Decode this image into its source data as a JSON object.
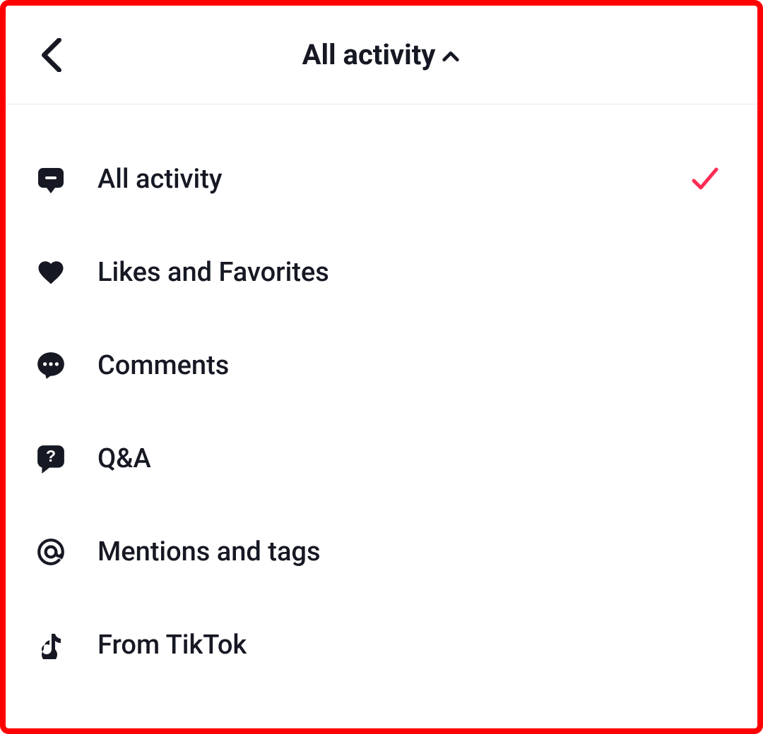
{
  "header": {
    "title": "All activity"
  },
  "filters": [
    {
      "label": "All activity",
      "icon": "activity-bubble",
      "selected": true
    },
    {
      "label": "Likes and Favorites",
      "icon": "heart",
      "selected": false
    },
    {
      "label": "Comments",
      "icon": "comment-dots",
      "selected": false
    },
    {
      "label": "Q&A",
      "icon": "qa-bubble",
      "selected": false
    },
    {
      "label": "Mentions and tags",
      "icon": "at-sign",
      "selected": false
    },
    {
      "label": "From TikTok",
      "icon": "tiktok-note",
      "selected": false
    }
  ],
  "colors": {
    "accent": "#FE2C55",
    "ink": "#161823"
  }
}
